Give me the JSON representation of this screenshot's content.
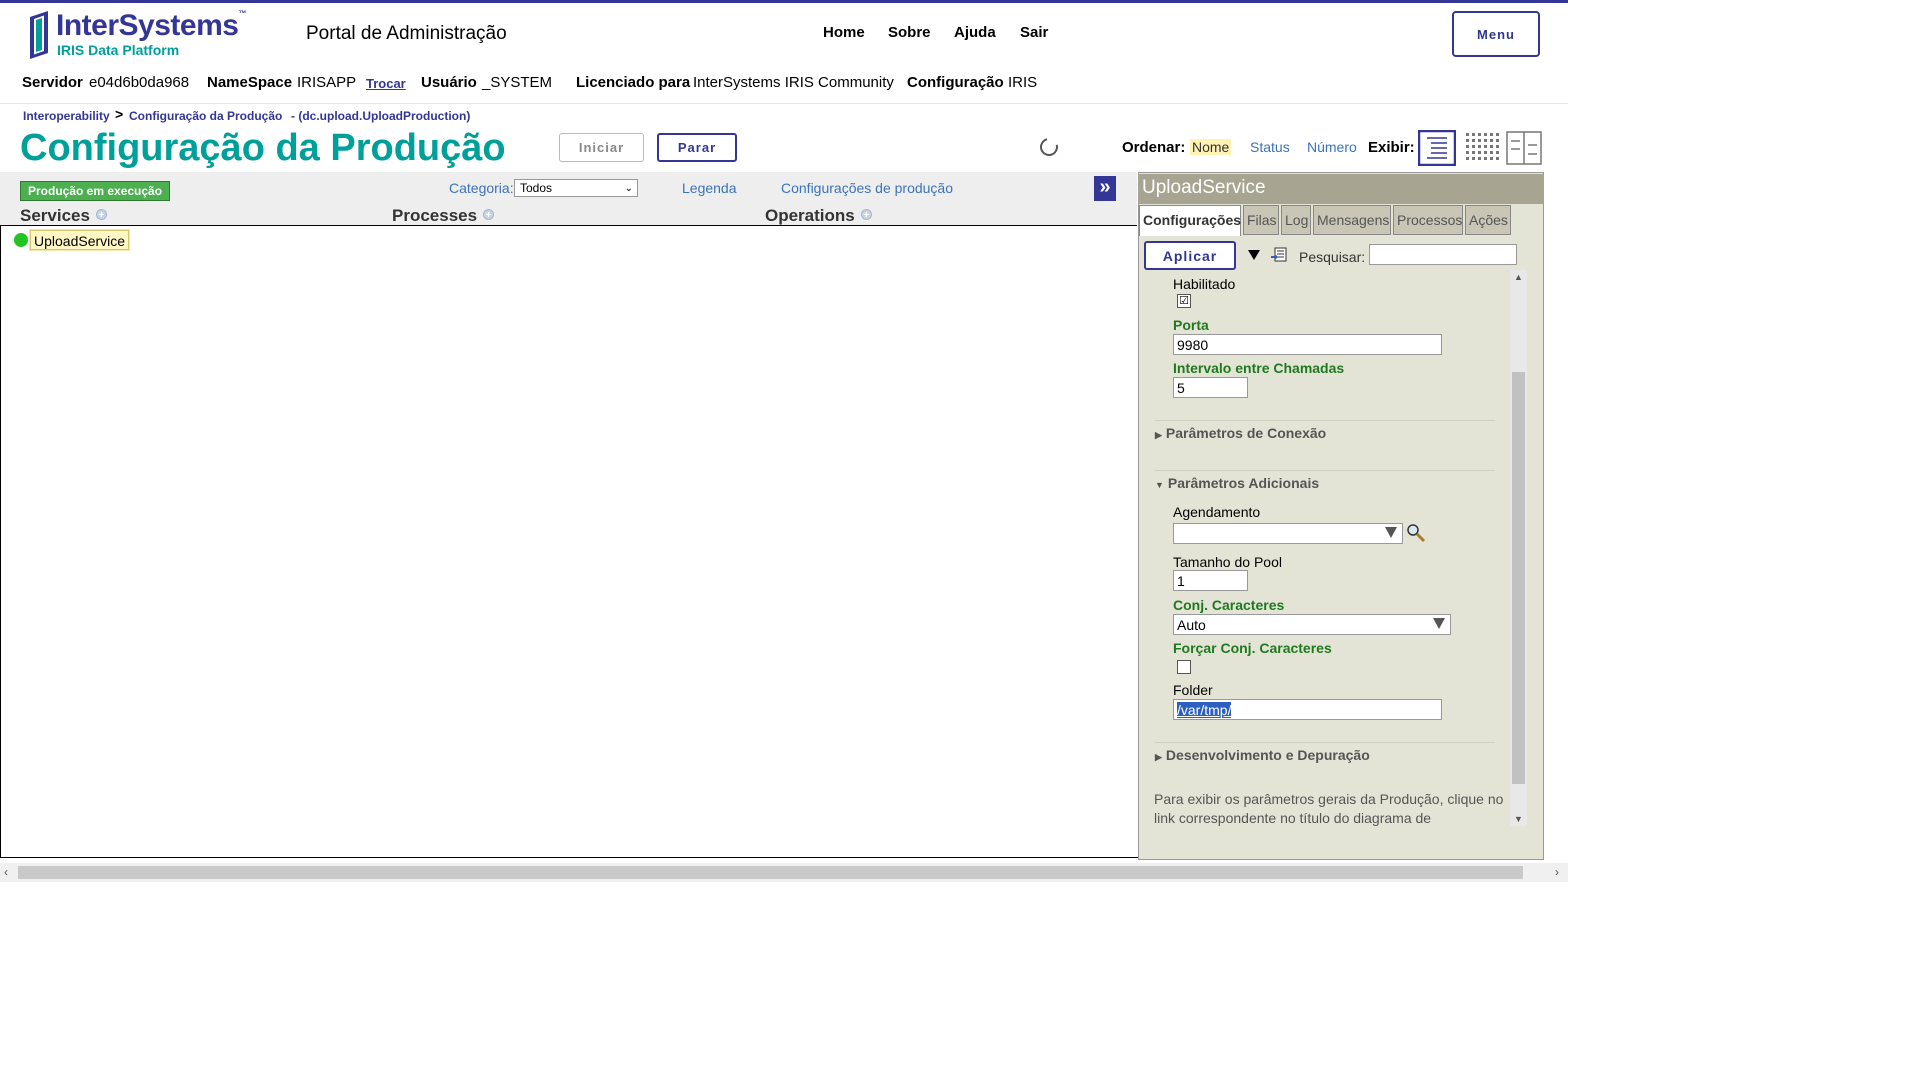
{
  "header": {
    "logo_text": "InterSystems",
    "logo_tm": "™",
    "logo_sub": "IRIS Data Platform",
    "portal_title": "Portal de Administração",
    "nav": [
      "Home",
      "Sobre",
      "Ajuda",
      "Sair"
    ],
    "menu_label": "Menu",
    "info": {
      "server_label": "Servidor",
      "server_value": "e04d6b0da968",
      "namespace_label": "NameSpace",
      "namespace_value": "IRISAPP",
      "switch_link": "Trocar",
      "user_label": "Usuário",
      "user_value": "_SYSTEM",
      "licensed_label": "Licenciado para",
      "licensed_value": "InterSystems IRIS Community",
      "config_label": "Configuração",
      "config_value": "IRIS"
    }
  },
  "breadcrumb": {
    "item1": "Interoperability",
    "sep": ">",
    "item2": "Configuração da Produção",
    "item3": "- (dc.upload.UploadProduction)"
  },
  "page": {
    "title": "Configuração da Produção",
    "start_button": "Iniciar",
    "stop_button": "Parar",
    "sort_label": "Ordenar:",
    "sort_options": [
      "Nome",
      "Status",
      "Número"
    ],
    "sort_selected": "Nome",
    "view_label": "Exibir:"
  },
  "diagram": {
    "status_badge": "Produção em execução",
    "category_label": "Categoria:",
    "category_value": "Todos",
    "legend_link": "Legenda",
    "settings_link": "Configurações de produção",
    "expand_icon": "»",
    "columns": [
      "Services",
      "Processes",
      "Operations"
    ],
    "services": [
      "UploadService"
    ],
    "service_status_color": "#22c422"
  },
  "panel": {
    "title": "UploadService",
    "tabs": [
      "Configurações",
      "Filas",
      "Log",
      "Mensagens",
      "Processos",
      "Ações"
    ],
    "active_tab": "Configurações",
    "apply_button": "Aplicar",
    "search_label": "Pesquisar:",
    "search_value": "",
    "fields": {
      "enabled_label": "Habilitado",
      "enabled_checked": "☑",
      "port_label": "Porta",
      "port_value": "9980",
      "interval_label": "Intervalo entre Chamadas",
      "interval_value": "5",
      "schedule_label": "Agendamento",
      "schedule_value": "",
      "pool_label": "Tamanho do Pool",
      "pool_value": "1",
      "charset_label": "Conj. Caracteres",
      "charset_value": "Auto",
      "force_charset_label": "Forçar Conj. Caracteres",
      "folder_label": "Folder",
      "folder_value": "/var/tmp/"
    },
    "sections": {
      "connection": "Parâmetros de Conexão",
      "additional": "Parâmetros Adicionais",
      "debug": "Desenvolvimento e Depuração"
    },
    "footnote": "Para exibir os parâmetros gerais da Produção, clique no link correspondente no título do diagrama de"
  },
  "colors": {
    "brand": "#333695",
    "accent": "#00a09a",
    "link": "#3b73b9",
    "running": "#4caf50"
  }
}
